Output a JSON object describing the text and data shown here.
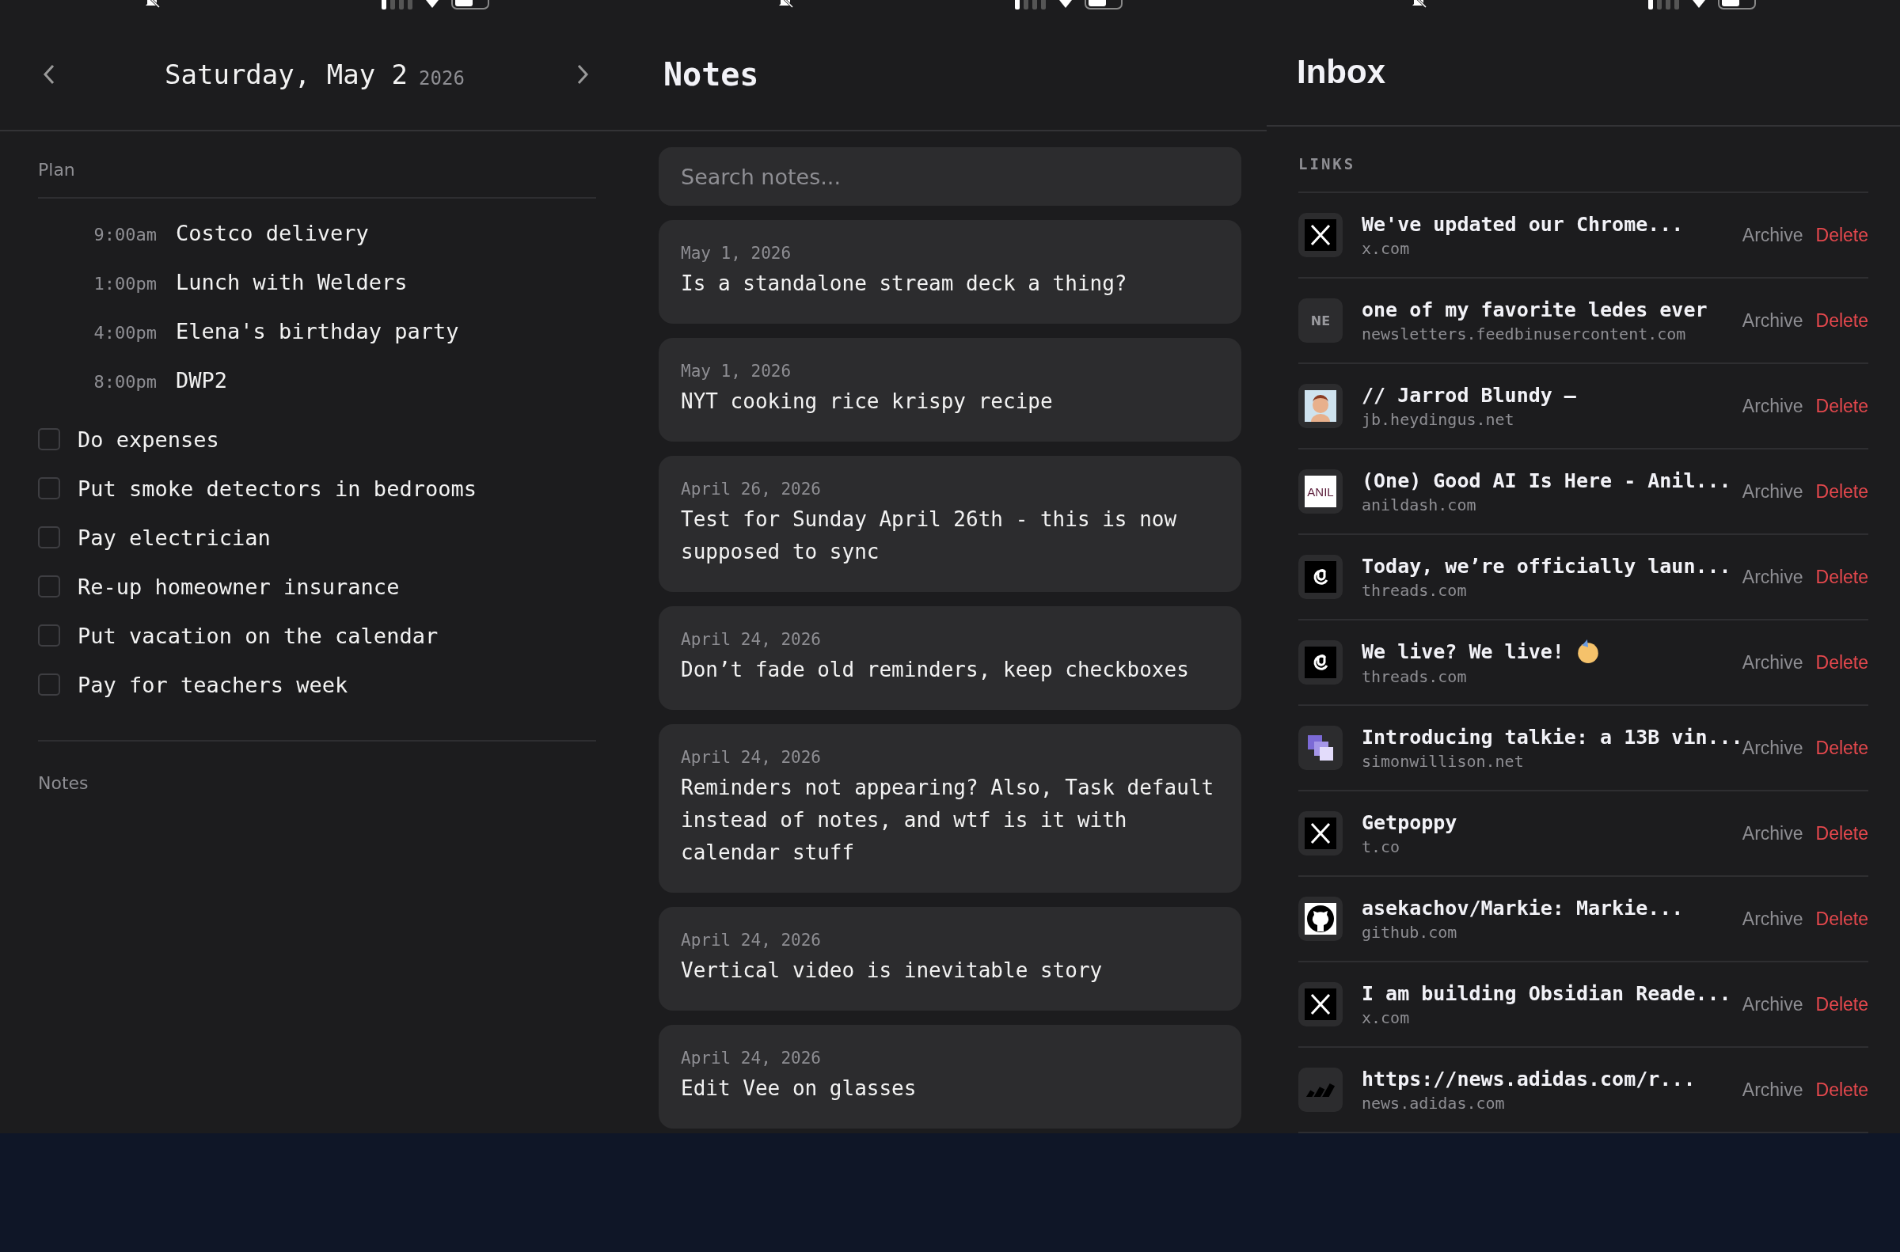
{
  "day": {
    "title": "Saturday, May 2",
    "year": "2026",
    "plan_label": "Plan",
    "events": [
      {
        "time": "9:00am",
        "title": "Costco delivery"
      },
      {
        "time": "1:00pm",
        "title": "Lunch with Welders"
      },
      {
        "time": "4:00pm",
        "title": "Elena's birthday party"
      },
      {
        "time": "8:00pm",
        "title": "DWP2"
      }
    ],
    "tasks": [
      {
        "label": "Do expenses",
        "checked": false
      },
      {
        "label": "Put smoke detectors in bedrooms",
        "checked": false
      },
      {
        "label": "Pay electrician",
        "checked": false
      },
      {
        "label": "Re-up homeowner insurance",
        "checked": false
      },
      {
        "label": "Put vacation on the calendar",
        "checked": false
      },
      {
        "label": "Pay for teachers week",
        "checked": false
      }
    ],
    "notes_label": "Notes"
  },
  "notes": {
    "title": "Notes",
    "search": {
      "placeholder": "Search notes..."
    },
    "items": [
      {
        "date": "May 1, 2026",
        "title": "Is a standalone stream deck a thing?"
      },
      {
        "date": "May 1, 2026",
        "title": "NYT cooking rice krispy recipe"
      },
      {
        "date": "April 26, 2026",
        "title": "Test for Sunday April 26th - this is now supposed to sync"
      },
      {
        "date": "April 24, 2026",
        "title": "Don’t fade old reminders, keep checkboxes"
      },
      {
        "date": "April 24, 2026",
        "title": "Reminders not appearing? Also, Task default instead of notes, and wtf is it with calendar stuff"
      },
      {
        "date": "April 24, 2026",
        "title": "Vertical video is inevitable story"
      },
      {
        "date": "April 24, 2026",
        "title": "Edit Vee on glasses"
      }
    ]
  },
  "inbox": {
    "title": "Inbox",
    "section": "LINKS",
    "links": [
      {
        "kind": "x",
        "title": "We've updated our Chrome...",
        "domain": "x.com",
        "archive": "Archive",
        "delete": "Delete"
      },
      {
        "kind": "text",
        "icon_text": "NE",
        "title": "one of my favorite ledes ever",
        "domain": "newsletters.feedbinusercontent.com",
        "archive": "Archive",
        "delete": "Delete"
      },
      {
        "kind": "avatar",
        "title": "// Jarrod Blundy —",
        "domain": "jb.heydingus.net",
        "archive": "Archive",
        "delete": "Delete"
      },
      {
        "kind": "wordmark",
        "icon_text": "ANIL",
        "title": "(One) Good AI Is Here - Anil...",
        "domain": "anildash.com",
        "archive": "Archive",
        "delete": "Delete"
      },
      {
        "kind": "threads",
        "title": "Today, we’re officially laun...",
        "domain": "threads.com",
        "archive": "Archive",
        "delete": "Delete"
      },
      {
        "kind": "threads",
        "title": "We live? We live!",
        "emoji": true,
        "domain": "threads.com",
        "archive": "Archive",
        "delete": "Delete"
      },
      {
        "kind": "squares",
        "title": "Introducing talkie: a 13B vin...",
        "domain": "simonwillison.net",
        "archive": "Archive",
        "delete": "Delete"
      },
      {
        "kind": "x",
        "title": "Getpoppy",
        "domain": "t.co",
        "archive": "Archive",
        "delete": "Delete"
      },
      {
        "kind": "cat",
        "title": "asekachov/Markie: Markie...",
        "domain": "github.com",
        "archive": "Archive",
        "delete": "Delete"
      },
      {
        "kind": "x",
        "title": "I am building Obsidian Reade...",
        "domain": "x.com",
        "archive": "Archive",
        "delete": "Delete"
      },
      {
        "kind": "stripes",
        "title": "https://news.adidas.com/r...",
        "domain": "news.adidas.com",
        "archive": "Archive",
        "delete": "Delete"
      }
    ]
  }
}
